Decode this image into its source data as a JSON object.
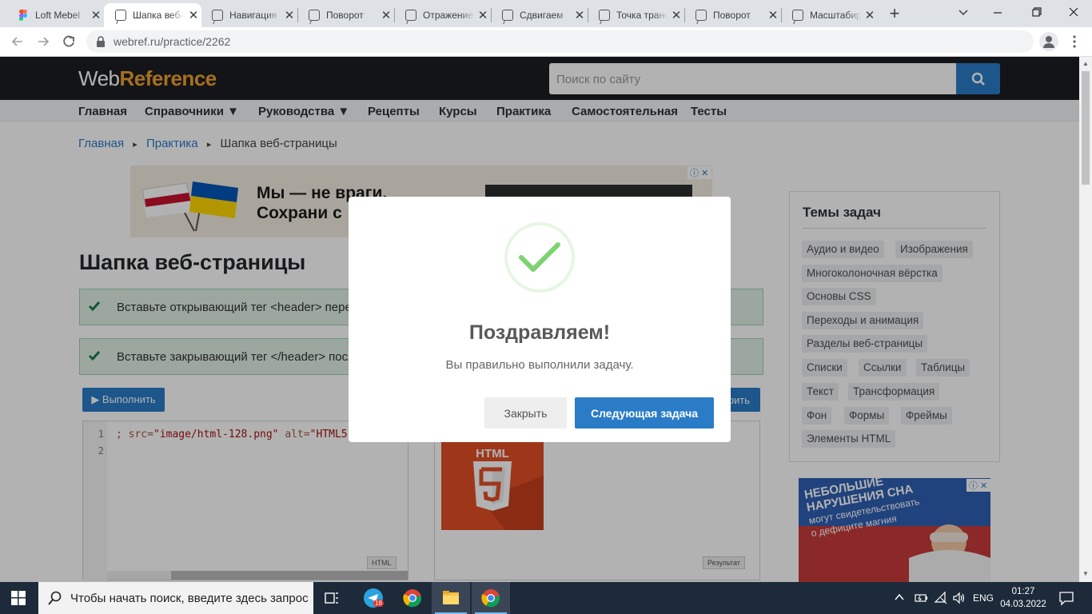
{
  "browser": {
    "tabs": [
      {
        "title": "Loft Mebel",
        "icon": "figma-icon"
      },
      {
        "title": "Шапка веб-страницы",
        "active": true
      },
      {
        "title": "Навигация"
      },
      {
        "title": "Поворот"
      },
      {
        "title": "Отражение"
      },
      {
        "title": "Сдвигаем"
      },
      {
        "title": "Точка трансформации"
      },
      {
        "title": "Поворот"
      },
      {
        "title": "Масштабирование"
      }
    ],
    "url": "webref.ru/practice/2262"
  },
  "site": {
    "logo_a": "Web",
    "logo_b": "Reference",
    "search_placeholder": "Поиск по сайту",
    "nav": [
      "Главная",
      "Справочники ▼",
      "Руководства ▼",
      "Рецепты",
      "Курсы",
      "Практика",
      "Самостоятельная",
      "Тесты"
    ],
    "breadcrumb": {
      "home": "Главная",
      "practice": "Практика",
      "sep": "▸",
      "current": "Шапка веб-страницы"
    }
  },
  "ad_top": {
    "line1": "Мы — не враги.",
    "line2": "Сохрани с"
  },
  "main": {
    "title": "Шапка веб-страницы",
    "tasks": [
      "Вставьте открывающий тег <header> пере",
      "Вставьте закрывающий тег </header> посл"
    ],
    "run_label": "▶ Выполнить",
    "check_label": "рить",
    "code_lines": [
      "1",
      "2"
    ],
    "code": {
      "a": "; src=",
      "b": "\"image/html-128.png\"",
      "c": " alt=",
      "d": "\"HTML5\"",
      "e": "><"
    },
    "editor_badge": "HTML",
    "result_badge": "Результат",
    "html5_logo": "HTML"
  },
  "sidebar": {
    "title": "Темы задач",
    "topics": [
      "Аудио и видео",
      "Изображения",
      "Многоколоночная вёрстка",
      "Основы CSS",
      "Переходы и анимация",
      "Разделы веб-страницы",
      "Списки",
      "Ссылки",
      "Таблицы",
      "Текст",
      "Трансформация",
      "Фон",
      "Формы",
      "Фреймы",
      "Элементы HTML"
    ]
  },
  "ad_side": {
    "line1": "НЕБОЛЬШИЕ",
    "line2": "НАРУШЕНИЯ СНА",
    "line3": "могут свидетельствовать",
    "line4": "о дефиците магния"
  },
  "modal": {
    "title": "Поздравляем!",
    "text": "Вы правильно выполнили задачу.",
    "close_label": "Закрыть",
    "next_label": "Следующая задача"
  },
  "taskbar": {
    "search_placeholder": "Чтобы начать поиск, введите здесь запрос",
    "telegram_badge": "18",
    "lang": "ENG",
    "time": "01:27",
    "date": "04.03.2022"
  },
  "colors": {
    "accent": "#2a7cc7",
    "logo_orange": "#f0a030",
    "success": "#6fd46f"
  }
}
